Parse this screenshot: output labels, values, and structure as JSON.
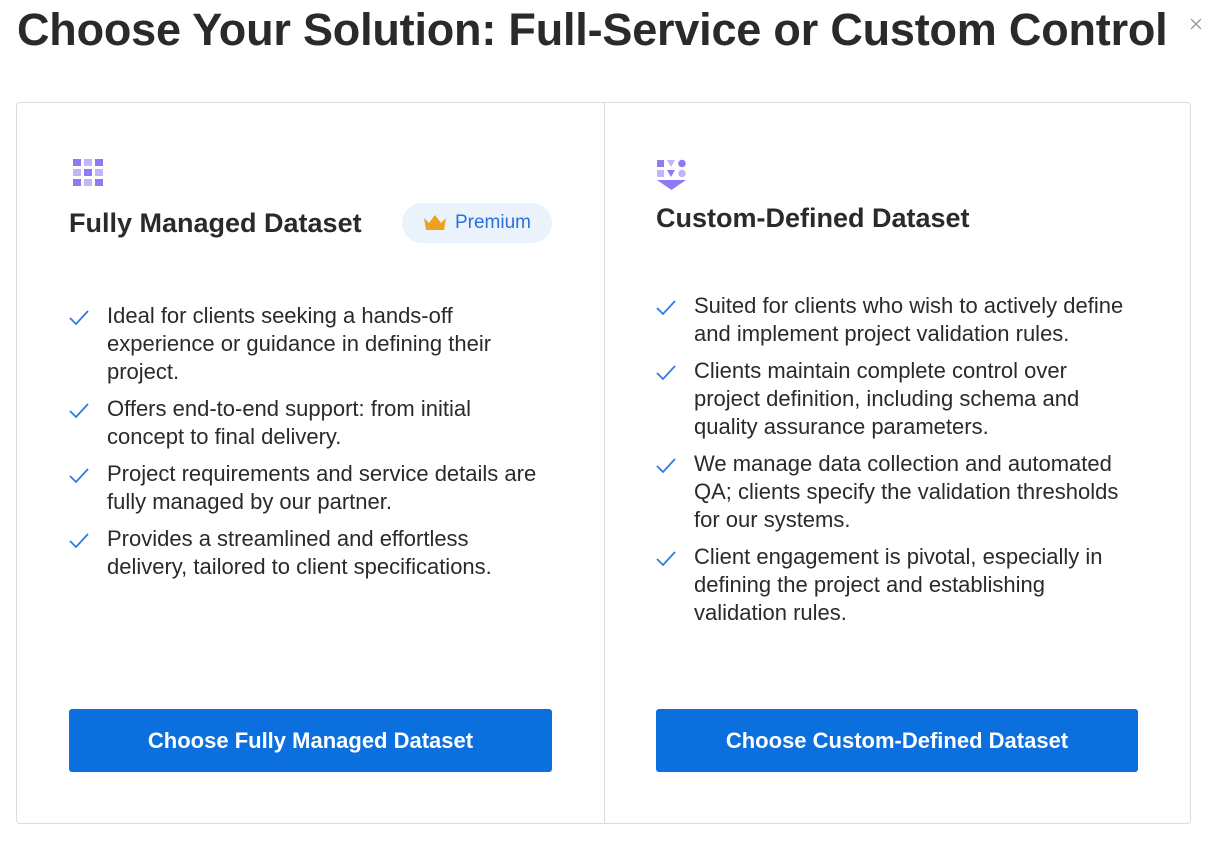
{
  "modal": {
    "title": "Choose Your Solution: Full-Service or Custom Control",
    "close_icon": "close-icon"
  },
  "colors": {
    "accent": "#0b6fde",
    "check": "#2f7ae0",
    "icon_purple": "#8b7cf6",
    "crown": "#f0a020",
    "badge_bg": "#eaf2fc",
    "badge_text": "#2f6fd8"
  },
  "cards": [
    {
      "icon": "grid-icon",
      "title": "Fully Managed Dataset",
      "badge": {
        "icon": "crown-icon",
        "label": "Premium"
      },
      "features": [
        "Ideal for clients seeking a hands-off experience or guidance in defining their project.",
        "Offers end-to-end support: from initial concept to final delivery.",
        "Project requirements and service details are fully managed by our partner.",
        "Provides a streamlined and effortless delivery, tailored to client specifications."
      ],
      "cta": "Choose Fully Managed Dataset"
    },
    {
      "icon": "shapes-funnel-icon",
      "title": "Custom-Defined Dataset",
      "features": [
        "Suited for clients who wish to actively define and implement project validation rules.",
        "Clients maintain complete control over project definition, including schema and quality assurance parameters.",
        "We manage data collection and automated QA; clients specify the validation thresholds for our systems.",
        "Client engagement is pivotal, especially in defining the project and establishing validation rules."
      ],
      "cta": "Choose Custom-Defined Dataset"
    }
  ]
}
